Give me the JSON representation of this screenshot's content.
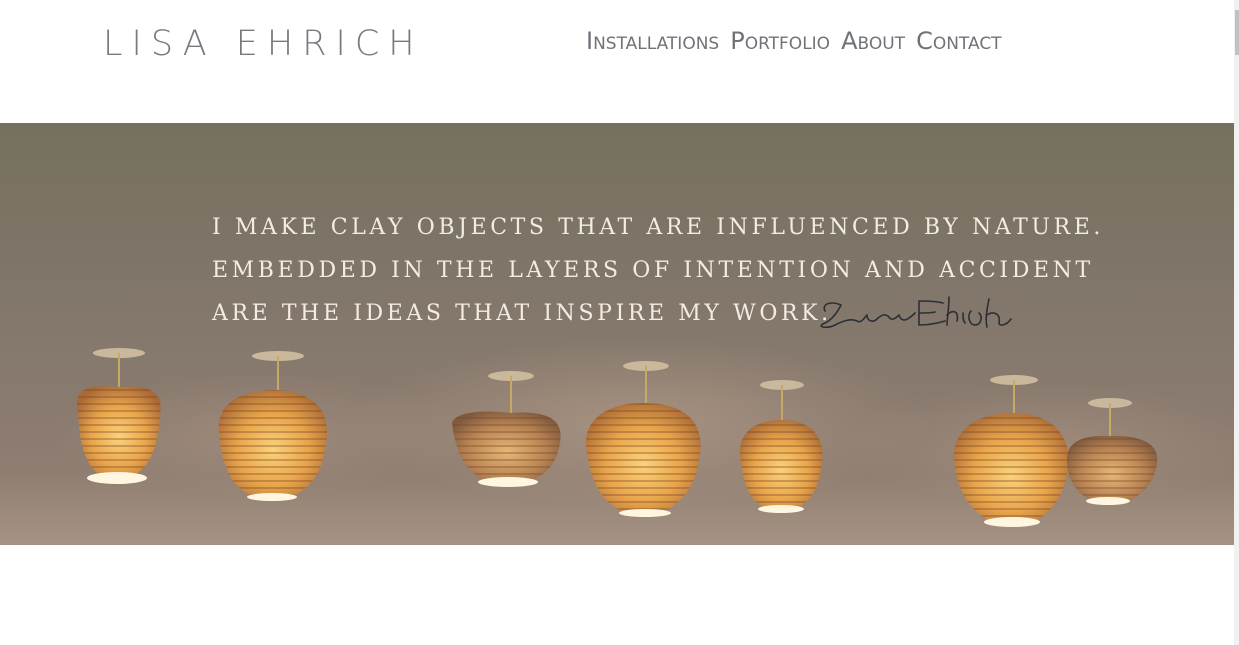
{
  "header": {
    "logo": "LISA EHRICH",
    "nav": [
      {
        "label": "Installations"
      },
      {
        "label": "Portfolio"
      },
      {
        "label": "About"
      },
      {
        "label": "Contact"
      }
    ]
  },
  "hero": {
    "quote_lines": [
      "I make clay objects that are influenced by nature.",
      "Embedded in the layers of intention and accident",
      "are the ideas that inspire my work."
    ],
    "signature": "Lisa Ehrich",
    "image_subject": "porcelain pendant lamps"
  },
  "colors": {
    "text_gray": "#767a80",
    "hero_bg": "#7d7567",
    "quote_text": "#f3ece3",
    "lamp_glow": "#f2b04a"
  }
}
